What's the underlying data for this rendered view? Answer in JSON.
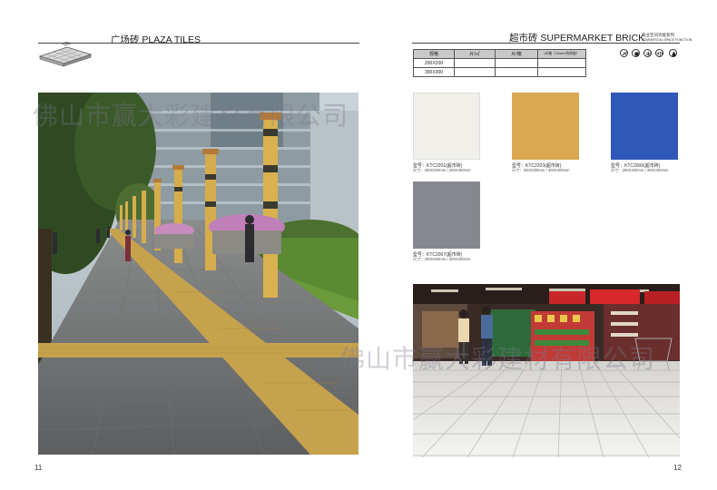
{
  "left_page": {
    "title": "广场砖 PLAZA TILES",
    "page_number": "11"
  },
  "right_page": {
    "title": "超市砖 SUPERMARKET BRICK",
    "subtitle_cn": "商业空间功能系列",
    "subtitle_en": "COMMERCIAL SPACE FUNCTION",
    "page_number": "12"
  },
  "spec_table": {
    "headers": [
      "规格",
      "片/㎡",
      "片/箱",
      "㎡/箱（15mm/块厚度）"
    ],
    "rows": [
      [
        "200X200",
        "",
        "",
        ""
      ],
      [
        "300X300",
        "",
        "",
        ""
      ]
    ]
  },
  "feature_icons": [
    "anti-slip-icon",
    "wear-resistant-icon",
    "frost-resistant-icon",
    "scale-icon",
    "water-drop-icon"
  ],
  "swatches": [
    {
      "color": "#f1efea",
      "model": "型号：KTC2201(超市砖)",
      "size": "尺寸：200X200mm / 300X300mm"
    },
    {
      "color": "#d9a851",
      "model": "型号：KTC2203(超市砖)",
      "size": "尺寸：200X200mm / 300X300mm"
    },
    {
      "color": "#2f58b8",
      "model": "型号：KTC2006(超市砖)",
      "size": "尺寸：200X200mm / 300X300mm"
    },
    {
      "color": "#86888f",
      "model": "型号：KTC2007(超市砖)",
      "size": "尺寸：200X200mm / 300X300mm"
    }
  ],
  "watermark": "佛山市赢大彩建材有限公司"
}
